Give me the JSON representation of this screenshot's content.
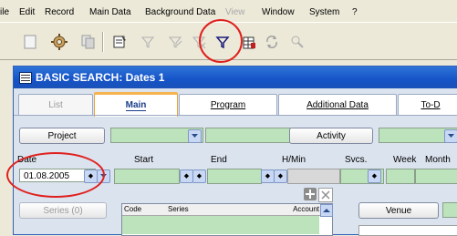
{
  "menu": {
    "items": [
      {
        "label": "File",
        "shown": "ile",
        "disabled": false
      },
      {
        "label": "Edit",
        "disabled": false
      },
      {
        "label": "Record",
        "disabled": false
      },
      {
        "label": "Main Data",
        "disabled": false
      },
      {
        "label": "Background Data",
        "disabled": false
      },
      {
        "label": "View",
        "disabled": true
      },
      {
        "label": "Window",
        "disabled": false
      },
      {
        "label": "System",
        "disabled": false
      },
      {
        "label": "?",
        "disabled": false
      }
    ]
  },
  "toolbar": {
    "icons": [
      "new-record-icon",
      "settings-gear-icon",
      "copy-icon",
      "form-icon",
      "filter-disabled-icon",
      "filter-edit-disabled-icon",
      "filter-clear-disabled-icon",
      "filter-icon",
      "filter-table-icon",
      "refresh-icon",
      "lookup-icon"
    ],
    "highlight_color": "#e0201e"
  },
  "window": {
    "title": "BASIC SEARCH: Dates  1",
    "tabs": [
      {
        "label": "List",
        "state": "inactive"
      },
      {
        "label": "Main",
        "state": "active"
      },
      {
        "label": "Program",
        "state": "normal"
      },
      {
        "label": "Additional Data",
        "state": "normal"
      },
      {
        "label": "To-D",
        "state": "normal"
      }
    ]
  },
  "form": {
    "project_button": "Project",
    "activity_button": "Activity",
    "labels": {
      "date": "Date",
      "start": "Start",
      "end": "End",
      "hmin": "H/Min",
      "svcs": "Svcs.",
      "week": "Week",
      "month": "Month"
    },
    "date_value": "01.08.2005",
    "series_button": "Series (0)",
    "venue_button": "Venue",
    "grid_headers": {
      "code": "Code",
      "series": "Series",
      "account": "Account"
    }
  },
  "colors": {
    "titlebar": "#1553c7",
    "field_green": "#bde3bd",
    "window_bg": "#dbe3ee",
    "active_tab_accent": "#f5b450"
  }
}
